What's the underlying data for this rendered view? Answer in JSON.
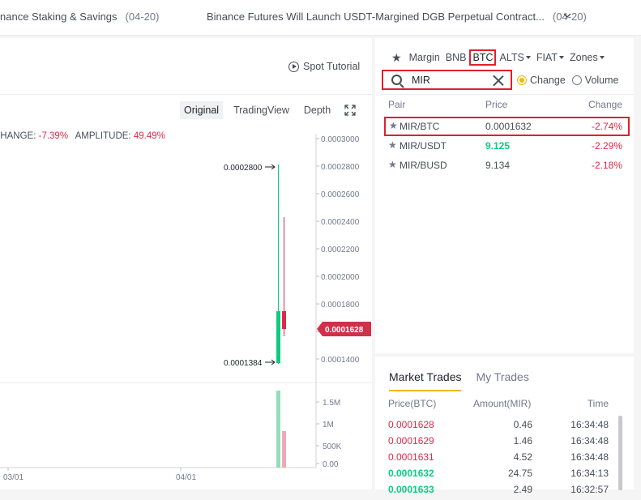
{
  "announcements": [
    {
      "text": "nance Staking & Savings",
      "date": "(04-20)"
    },
    {
      "text": "Binance Futures Will Launch USDT-Margined DGB Perpetual Contract...",
      "date": "(04-20)"
    }
  ],
  "chart": {
    "spot_tutorial": "Spot Tutorial",
    "tabs": [
      "Original",
      "TradingView",
      "Depth"
    ],
    "stats": {
      "change_label": "CHANGE:",
      "change_value": "-7.39%",
      "amplitude_label": "AMPLITUDE:",
      "amplitude_value": "49.49%"
    },
    "price_ticks": [
      "0.0003000",
      "0.0002800",
      "0.0002600",
      "0.0002400",
      "0.0002200",
      "0.0002000",
      "0.0001800",
      "0.0001600",
      "0.0001400"
    ],
    "volume_ticks": [
      "1.5M",
      "1M",
      "500K",
      "0.00"
    ],
    "date_ticks": [
      "03/01",
      "04/01"
    ],
    "high_label": "0.0002800",
    "low_label": "0.0001384",
    "current_price": "0.0001628",
    "colors": {
      "up": "#0ecb81",
      "down": "#e0294a",
      "up_vol": "#94dcbb",
      "down_vol": "#f0a8b5"
    }
  },
  "markets": {
    "favorites_icon": "star-icon",
    "categories": [
      {
        "label": "Margin",
        "caret": false,
        "selected": false
      },
      {
        "label": "BNB",
        "caret": false,
        "selected": false
      },
      {
        "label": "BTC",
        "caret": false,
        "selected": true
      },
      {
        "label": "ALTS",
        "caret": true,
        "selected": false
      },
      {
        "label": "FIAT",
        "caret": true,
        "selected": false
      },
      {
        "label": "Zones",
        "caret": true,
        "selected": false
      }
    ],
    "search_value": "MIR",
    "radio": {
      "change": "Change",
      "volume": "Volume",
      "selected": "change"
    },
    "headers": {
      "pair": "Pair",
      "price": "Price",
      "change": "Change"
    },
    "pairs": [
      {
        "pair": "MIR/BTC",
        "price": "0.0001632",
        "change": "-2.74%",
        "price_color": "neutral",
        "highlighted": true
      },
      {
        "pair": "MIR/USDT",
        "price": "9.125",
        "change": "-2.29%",
        "price_color": "green",
        "highlighted": false
      },
      {
        "pair": "MIR/BUSD",
        "price": "9.134",
        "change": "-2.18%",
        "price_color": "neutral",
        "highlighted": false
      }
    ]
  },
  "trades": {
    "tabs": [
      "Market Trades",
      "My Trades"
    ],
    "headers": {
      "price": "Price(BTC)",
      "amount": "Amount(MIR)",
      "time": "Time"
    },
    "rows": [
      {
        "price": "0.0001628",
        "amount": "0.46",
        "time": "16:34:48",
        "side": "sell"
      },
      {
        "price": "0.0001629",
        "amount": "1.46",
        "time": "16:34:48",
        "side": "sell"
      },
      {
        "price": "0.0001631",
        "amount": "4.52",
        "time": "16:34:48",
        "side": "sell"
      },
      {
        "price": "0.0001632",
        "amount": "24.75",
        "time": "16:34:13",
        "side": "buy"
      },
      {
        "price": "0.0001633",
        "amount": "2.49",
        "time": "16:32:57",
        "side": "buy"
      }
    ]
  }
}
